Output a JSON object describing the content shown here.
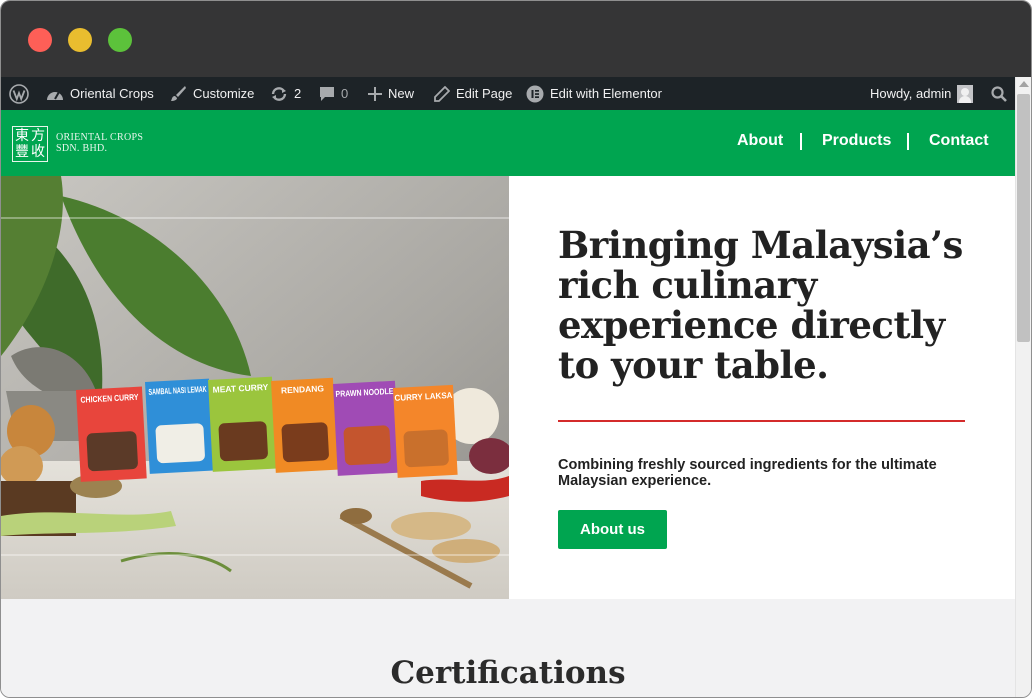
{
  "adminbar": {
    "site_name": "Oriental Crops",
    "customize": "Customize",
    "updates_count": "2",
    "comments_count": "0",
    "new_label": "New",
    "edit_page": "Edit Page",
    "edit_elementor": "Edit with Elementor",
    "howdy": "Howdy, admin"
  },
  "header": {
    "logo_chars": [
      "東",
      "方",
      "豐",
      "收"
    ],
    "logo_line1": "ORIENTAL CROPS",
    "logo_line2": "SDN. BHD.",
    "nav": [
      "About",
      "Products",
      "Contact"
    ]
  },
  "hero": {
    "title": "Bringing Malaysia’s rich culinary experience directly to your table.",
    "subtitle": "Combining freshly sourced ingredients for the ultimate Malaysian experience.",
    "button": "About us",
    "packs": [
      "CHICKEN CURRY",
      "SAMBAL NASI LEMAK",
      "MEAT CURRY",
      "RENDANG",
      "PRAWN NOODLE",
      "CURRY LAKSA"
    ],
    "pack_colors": [
      "#e8453c",
      "#2f8fd8",
      "#9bc53d",
      "#f08a24",
      "#a04bb5",
      "#f4862a"
    ]
  },
  "sections": {
    "certifications_title": "Certifications"
  },
  "colors": {
    "brand_green": "#00a550",
    "accent_red": "#d42b2b",
    "adminbar_bg": "#1d2327"
  }
}
